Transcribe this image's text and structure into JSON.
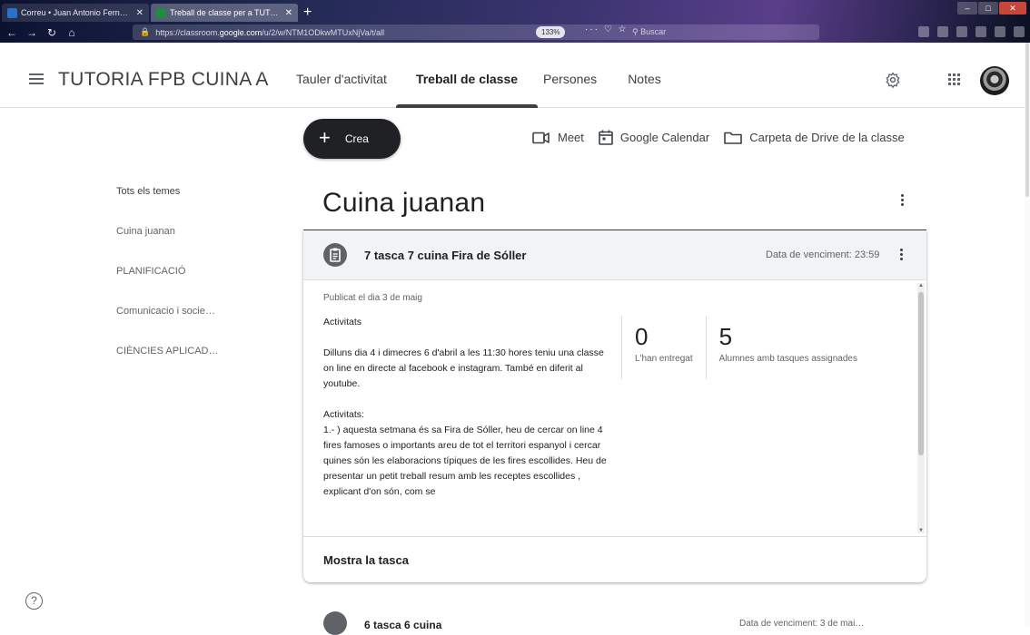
{
  "browser": {
    "tabs": [
      {
        "title": "Correu • Juan Antonio Fernand…",
        "active": false,
        "favicon_color": "#2a72c8"
      },
      {
        "title": "Treball de classe per a TUTORI…",
        "active": true,
        "favicon_color": "#1e8e3e"
      }
    ],
    "new_tab": "+",
    "url_prefix": "https://classroom.",
    "url_domain": "google.com",
    "url_path": "/u/2/w/NTM1ODkwMTUxNjVa/t/all",
    "zoom": "133%",
    "page_actions": "··· ♡ ☆",
    "search_placeholder": "Buscar",
    "close_mark": "✕"
  },
  "header": {
    "class_name": "TUTORIA FPB CUINA A",
    "tabs": [
      {
        "label": "Tauler d'activitat",
        "active": false
      },
      {
        "label": "Treball de classe",
        "active": true
      },
      {
        "label": "Persones",
        "active": false
      },
      {
        "label": "Notes",
        "active": false
      }
    ]
  },
  "toolbar": {
    "create_label": "Crea",
    "meet_label": "Meet",
    "calendar_label": "Google Calendar",
    "drive_label": "Carpeta de Drive de la classe"
  },
  "topics": {
    "items": [
      "Tots els temes",
      "Cuina juanan",
      "PLANIFICACIÓ",
      "Comunicacio i socie…",
      "CIÈNCIES APLICAD…"
    ]
  },
  "section": {
    "title": "Cuina juanan"
  },
  "assignment": {
    "title": "7 tasca 7 cuina Fira de Sóller",
    "due": "Data de venciment: 23:59",
    "published": "Publicat el dia 3 de maig",
    "paragraphs": [
      "Activitats",
      "Dilluns dia 4 i dimecres 6 d'abril a les 11:30 hores teniu una classe on line en directe al facebook e instagram. També en diferit al youtube.",
      "Activitats:\n1.- ) aquesta setmana és sa Fira de Sóller, heu de cercar on line 4 fires famoses o importants areu de tot el territori espanyol i cercar quines són les elaboracions típiques de les fires escollides. Heu de presentar un petit treball resum amb les receptes escollides , explicant d'on són, com se"
    ],
    "turned_in_count": "0",
    "turned_in_label": "L'han entregat",
    "assigned_count": "5",
    "assigned_label": "Alumnes amb tasques assignades",
    "show_label": "Mostra la tasca"
  },
  "next_assignment": {
    "title": "6 tasca 6 cuina",
    "due": "Data de venciment: 3 de mai…"
  },
  "help_label": "?",
  "colors": {
    "primary_dark": "#202124",
    "text": "#3c4043",
    "muted": "#5f6368",
    "card_header": "#f1f3f4",
    "divider": "#dadce0"
  }
}
